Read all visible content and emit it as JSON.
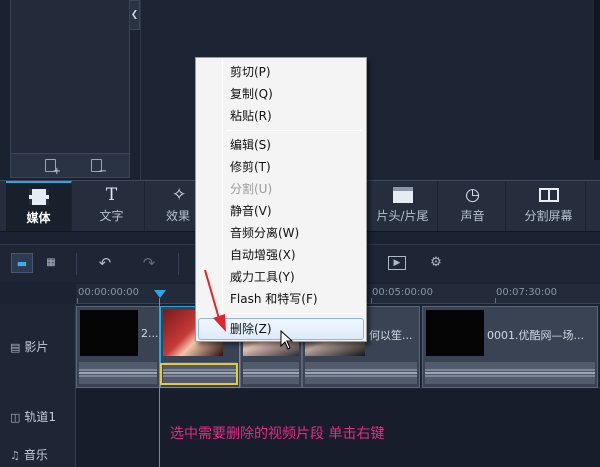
{
  "category_tabs": [
    {
      "label": "媒体",
      "icon": "film-icon"
    },
    {
      "label": "文字",
      "icon": "text-icon"
    },
    {
      "label": "效果",
      "icon": "magic-wand-icon"
    },
    {
      "label": "片头/片尾",
      "icon": "clapper-icon"
    },
    {
      "label": "声音",
      "icon": "headphones-icon"
    },
    {
      "label": "分割屏幕",
      "icon": "split-screen-icon"
    }
  ],
  "text_icon_glyph": "T",
  "ruler": {
    "labels": [
      "00:00:00:00",
      "00:05:00:00",
      "00:07:30:00"
    ]
  },
  "tracks": [
    {
      "label": "影片",
      "icon": "film-strip-icon"
    },
    {
      "label": "轨道1",
      "icon": "overlay-track-icon"
    },
    {
      "label": "音乐",
      "icon": "music-note-icon"
    }
  ],
  "clips": [
    {
      "label": "2..."
    },
    {
      "label": "何以笙..."
    },
    {
      "label": "0001.优酷网—场..."
    }
  ],
  "context_menu": {
    "items": [
      {
        "label": "剪切(P)"
      },
      {
        "label": "复制(Q)"
      },
      {
        "label": "粘贴(R)"
      },
      {
        "label": "编辑(S)"
      },
      {
        "label": "修剪(T)"
      },
      {
        "label": "分割(U)"
      },
      {
        "label": "静音(V)"
      },
      {
        "label": "音频分离(W)"
      },
      {
        "label": "自动增强(X)"
      },
      {
        "label": "威力工具(Y)"
      },
      {
        "label": "Flash 和特写(F)"
      },
      {
        "label": "删除(Z)"
      }
    ],
    "disabled": [
      "分割(U)"
    ],
    "highlighted": "删除(Z)"
  },
  "instruction": "选中需要删除的视频片段  单击右键",
  "colors": {
    "accent": "#2aa7e0",
    "instruction": "#e02c86",
    "selection": "#e7c836",
    "arrow": "#e0262a"
  }
}
